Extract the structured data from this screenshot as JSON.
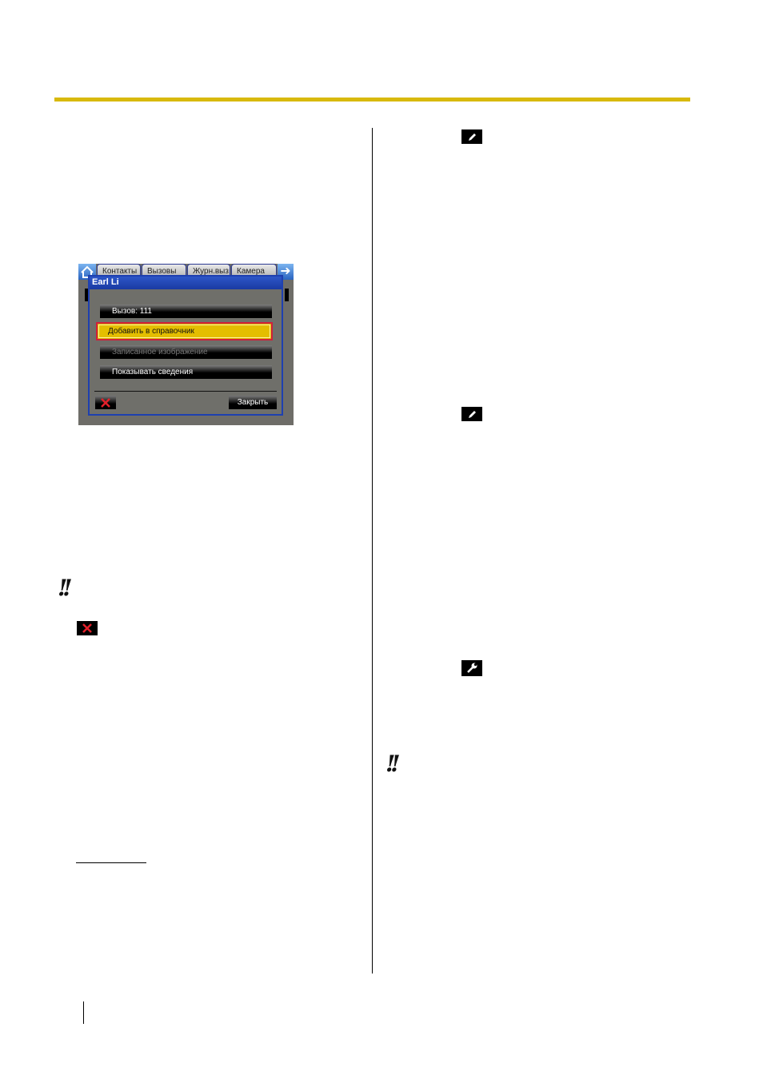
{
  "screen": {
    "tabs": [
      "Контакты",
      "Вызовы",
      "Журн.выз.",
      "Камера"
    ],
    "dialog_title": "Earl Li",
    "options": [
      {
        "label": "Вызов: 111",
        "state": "normal"
      },
      {
        "label": "Добавить в справочник",
        "state": "selected"
      },
      {
        "label": "Записанное изображение",
        "state": "disabled"
      },
      {
        "label": "Показывать сведения",
        "state": "normal"
      }
    ],
    "close_label": "Закрыть"
  },
  "colors": {
    "accent_rule": "#d8b90c",
    "selection": "#e4be00",
    "selection_border": "#d0203b",
    "dialog_border": "#1e40b0"
  },
  "icons": [
    "edit-icon",
    "delete-icon",
    "settings-wrench-icon",
    "note-icon",
    "home-icon",
    "next-arrow-icon"
  ],
  "note_marks": [
    "!!",
    "!!"
  ]
}
